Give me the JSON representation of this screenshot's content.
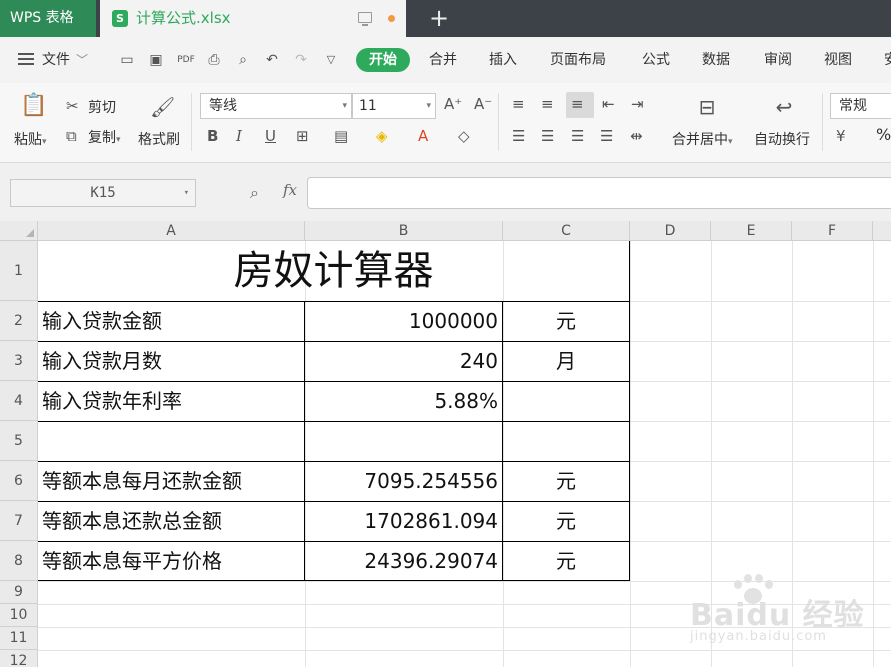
{
  "titlebar": {
    "app_name": "WPS 表格",
    "doc_name": "计算公式.xlsx",
    "new_tab": "+"
  },
  "menubar": {
    "file": "文件",
    "items": [
      "开始",
      "合并",
      "插入",
      "页面布局",
      "公式",
      "数据",
      "审阅",
      "视图",
      "安"
    ]
  },
  "ribbon": {
    "paste": "粘贴",
    "cut": "剪切",
    "copy": "复制",
    "format_painter": "格式刷",
    "font_name": "等线",
    "font_size": "11",
    "merge_center": "合并居中",
    "wrap_text": "自动换行",
    "number_format": "常规",
    "percent": "%"
  },
  "formulabar": {
    "name_box": "K15",
    "fx": "fx",
    "formula": ""
  },
  "grid": {
    "columns": [
      "A",
      "B",
      "C",
      "D",
      "E",
      "F"
    ],
    "rows": [
      "1",
      "2",
      "3",
      "4",
      "5",
      "6",
      "7",
      "8",
      "9",
      "10",
      "11",
      "12"
    ],
    "title": "房奴计算器",
    "cells": {
      "A2": "输入贷款金额",
      "B2": "1000000",
      "C2": "元",
      "A3": "输入贷款月数",
      "B3": "240",
      "C3": "月",
      "A4": "输入贷款年利率",
      "B4": "5.88%",
      "C4": "",
      "A6": "等额本息每月还款金额",
      "B6": "7095.254556",
      "C6": "元",
      "A7": "等额本息还款总金额",
      "B7": "1702861.094",
      "C7": "元",
      "A8": "等额本息每平方价格",
      "B8": "24396.29074",
      "C8": "元"
    }
  },
  "watermark": {
    "brand": "Baidu 经验",
    "url": "jingyan.baidu.com"
  }
}
